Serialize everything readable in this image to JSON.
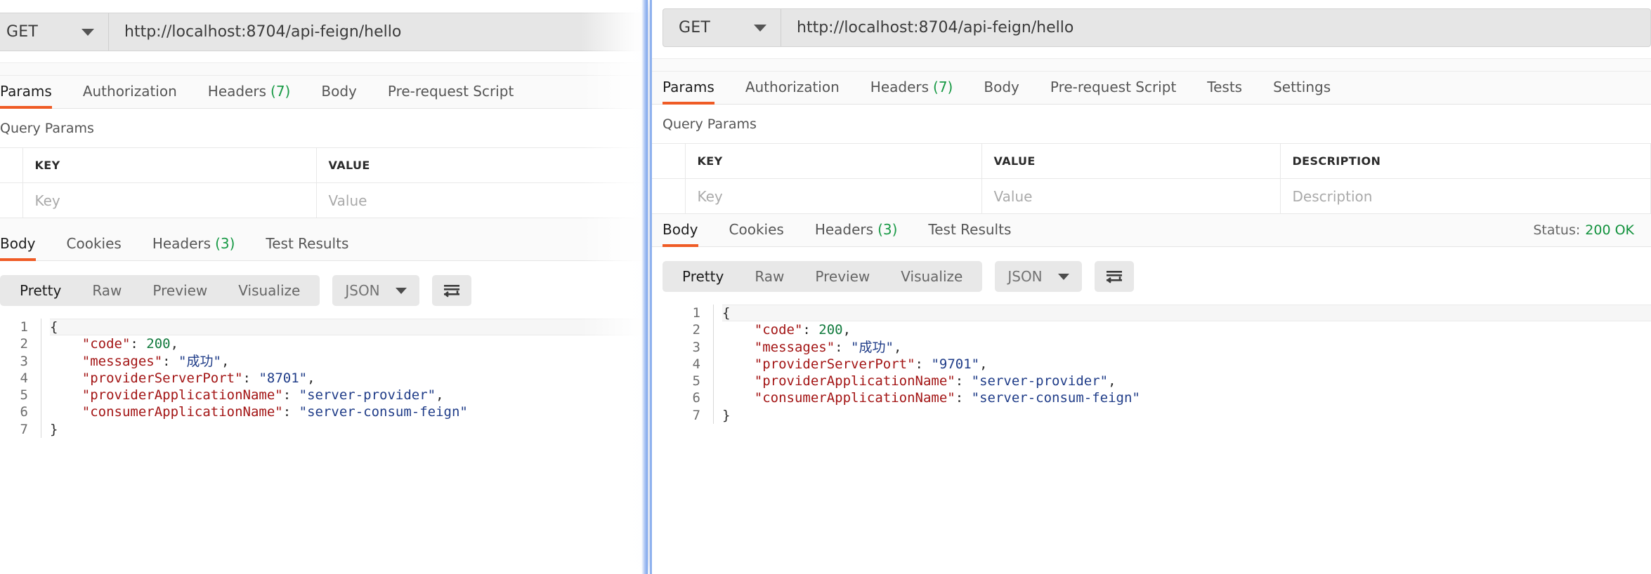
{
  "back_window": {
    "request": {
      "method": "GET",
      "url": "http://localhost:8704/api-feign/hello"
    },
    "tabs": [
      {
        "label": "Params",
        "count": "",
        "active": true
      },
      {
        "label": "Authorization",
        "count": "",
        "active": false
      },
      {
        "label": "Headers",
        "count": "(7)",
        "active": false
      },
      {
        "label": "Body",
        "count": "",
        "active": false
      },
      {
        "label": "Pre-request Script",
        "count": "",
        "active": false
      }
    ],
    "query_params": {
      "title": "Query Params",
      "headers": [
        "KEY",
        "VALUE"
      ],
      "rows": [
        {
          "key_placeholder": "Key",
          "value_placeholder": "Value"
        }
      ]
    },
    "response": {
      "tabs": [
        {
          "label": "Body",
          "count": "",
          "active": true
        },
        {
          "label": "Cookies",
          "count": "",
          "active": false
        },
        {
          "label": "Headers",
          "count": "(3)",
          "active": false
        },
        {
          "label": "Test Results",
          "count": "",
          "active": false
        }
      ],
      "view_modes": [
        "Pretty",
        "Raw",
        "Preview",
        "Visualize"
      ],
      "active_view_mode": "Pretty",
      "format": "JSON",
      "wrap_icon": "wrap-lines-icon",
      "code": {
        "line_numbers": [
          "1",
          "2",
          "3",
          "4",
          "5",
          "6",
          "7"
        ],
        "lines": [
          [
            {
              "t": "{",
              "c": "p"
            }
          ],
          [
            {
              "t": "    ",
              "c": "p"
            },
            {
              "t": "\"code\"",
              "c": "k"
            },
            {
              "t": ": ",
              "c": "p"
            },
            {
              "t": "200",
              "c": "n"
            },
            {
              "t": ",",
              "c": "p"
            }
          ],
          [
            {
              "t": "    ",
              "c": "p"
            },
            {
              "t": "\"messages\"",
              "c": "k"
            },
            {
              "t": ": ",
              "c": "p"
            },
            {
              "t": "\"成功\"",
              "c": "s"
            },
            {
              "t": ",",
              "c": "p"
            }
          ],
          [
            {
              "t": "    ",
              "c": "p"
            },
            {
              "t": "\"providerServerPort\"",
              "c": "k"
            },
            {
              "t": ": ",
              "c": "p"
            },
            {
              "t": "\"8701\"",
              "c": "s"
            },
            {
              "t": ",",
              "c": "p"
            }
          ],
          [
            {
              "t": "    ",
              "c": "p"
            },
            {
              "t": "\"providerApplicationName\"",
              "c": "k"
            },
            {
              "t": ": ",
              "c": "p"
            },
            {
              "t": "\"server-provider\"",
              "c": "s"
            },
            {
              "t": ",",
              "c": "p"
            }
          ],
          [
            {
              "t": "    ",
              "c": "p"
            },
            {
              "t": "\"consumerApplicationName\"",
              "c": "k"
            },
            {
              "t": ": ",
              "c": "p"
            },
            {
              "t": "\"server-consum-feign\"",
              "c": "s"
            }
          ],
          [
            {
              "t": "}",
              "c": "p"
            }
          ]
        ]
      }
    }
  },
  "front_window": {
    "request": {
      "method": "GET",
      "url": "http://localhost:8704/api-feign/hello"
    },
    "tabs": [
      {
        "label": "Params",
        "count": "",
        "active": true
      },
      {
        "label": "Authorization",
        "count": "",
        "active": false
      },
      {
        "label": "Headers",
        "count": "(7)",
        "active": false
      },
      {
        "label": "Body",
        "count": "",
        "active": false
      },
      {
        "label": "Pre-request Script",
        "count": "",
        "active": false
      },
      {
        "label": "Tests",
        "count": "",
        "active": false
      },
      {
        "label": "Settings",
        "count": "",
        "active": false
      }
    ],
    "query_params": {
      "title": "Query Params",
      "headers": [
        "KEY",
        "VALUE",
        "DESCRIPTION"
      ],
      "rows": [
        {
          "key_placeholder": "Key",
          "value_placeholder": "Value",
          "description_placeholder": "Description"
        }
      ]
    },
    "response": {
      "tabs": [
        {
          "label": "Body",
          "count": "",
          "active": true
        },
        {
          "label": "Cookies",
          "count": "",
          "active": false
        },
        {
          "label": "Headers",
          "count": "(3)",
          "active": false
        },
        {
          "label": "Test Results",
          "count": "",
          "active": false
        }
      ],
      "status_label": "Status:",
      "status_value": "200 OK",
      "view_modes": [
        "Pretty",
        "Raw",
        "Preview",
        "Visualize"
      ],
      "active_view_mode": "Pretty",
      "format": "JSON",
      "wrap_icon": "wrap-lines-icon",
      "code": {
        "line_numbers": [
          "1",
          "2",
          "3",
          "4",
          "5",
          "6",
          "7"
        ],
        "lines": [
          [
            {
              "t": "{",
              "c": "p"
            }
          ],
          [
            {
              "t": "    ",
              "c": "p"
            },
            {
              "t": "\"code\"",
              "c": "k"
            },
            {
              "t": ": ",
              "c": "p"
            },
            {
              "t": "200",
              "c": "n"
            },
            {
              "t": ",",
              "c": "p"
            }
          ],
          [
            {
              "t": "    ",
              "c": "p"
            },
            {
              "t": "\"messages\"",
              "c": "k"
            },
            {
              "t": ": ",
              "c": "p"
            },
            {
              "t": "\"成功\"",
              "c": "s"
            },
            {
              "t": ",",
              "c": "p"
            }
          ],
          [
            {
              "t": "    ",
              "c": "p"
            },
            {
              "t": "\"providerServerPort\"",
              "c": "k"
            },
            {
              "t": ": ",
              "c": "p"
            },
            {
              "t": "\"9701\"",
              "c": "s"
            },
            {
              "t": ",",
              "c": "p"
            }
          ],
          [
            {
              "t": "    ",
              "c": "p"
            },
            {
              "t": "\"providerApplicationName\"",
              "c": "k"
            },
            {
              "t": ": ",
              "c": "p"
            },
            {
              "t": "\"server-provider\"",
              "c": "s"
            },
            {
              "t": ",",
              "c": "p"
            }
          ],
          [
            {
              "t": "    ",
              "c": "p"
            },
            {
              "t": "\"consumerApplicationName\"",
              "c": "k"
            },
            {
              "t": ": ",
              "c": "p"
            },
            {
              "t": "\"server-consum-feign\"",
              "c": "s"
            }
          ],
          [
            {
              "t": "}",
              "c": "p"
            }
          ]
        ]
      }
    }
  },
  "colors": {
    "accent": "#ef5b25",
    "success": "#11913c",
    "count_badge": "#199a46",
    "json_key": "#a31515",
    "json_string": "#1f3c88",
    "json_number": "#117a3d",
    "window_edge": "#8fb2ee"
  }
}
